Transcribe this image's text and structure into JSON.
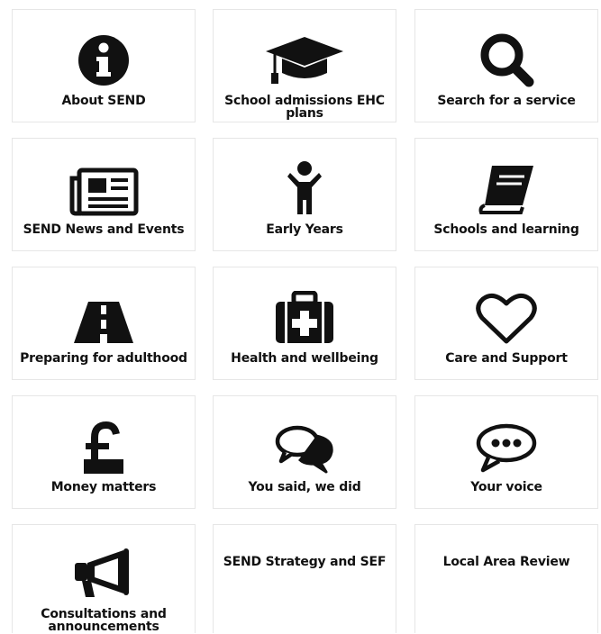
{
  "tiles": [
    {
      "label": "About SEND",
      "icon": "info-icon"
    },
    {
      "label": "School admissions EHC plans",
      "icon": "graduation-cap-icon"
    },
    {
      "label": "Search for a service",
      "icon": "search-icon"
    },
    {
      "label": "SEND News and Events",
      "icon": "newspaper-icon"
    },
    {
      "label": "Early Years",
      "icon": "child-icon"
    },
    {
      "label": "Schools and learning",
      "icon": "book-icon"
    },
    {
      "label": "Preparing for adulthood",
      "icon": "road-icon"
    },
    {
      "label": "Health and wellbeing",
      "icon": "medkit-icon"
    },
    {
      "label": "Care and Support",
      "icon": "heart-icon"
    },
    {
      "label": "Money matters",
      "icon": "pound-icon"
    },
    {
      "label": "You said, we did",
      "icon": "speech-bubbles-icon"
    },
    {
      "label": "Your voice",
      "icon": "comment-dots-icon"
    },
    {
      "label": "Consultations and announcements",
      "icon": "megaphone-icon"
    },
    {
      "label": "SEND Strategy and SEF",
      "icon": ""
    },
    {
      "label": "Local Area Review",
      "icon": ""
    }
  ]
}
